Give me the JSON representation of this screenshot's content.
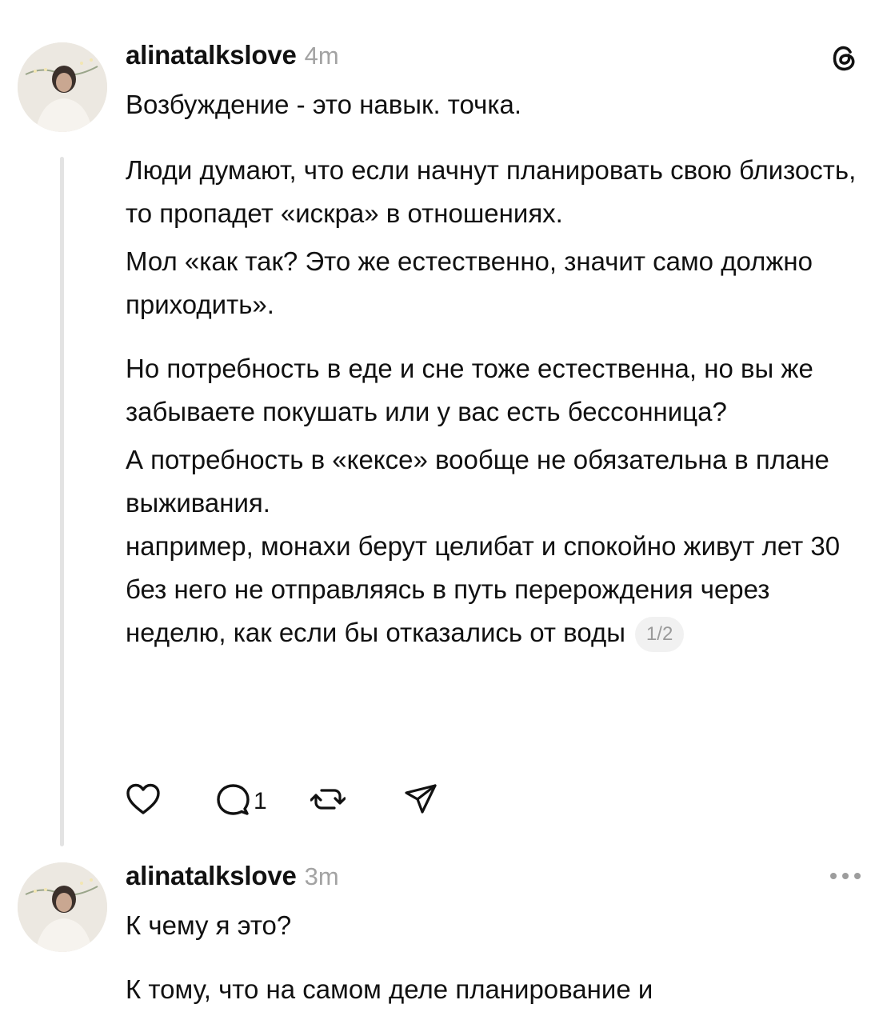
{
  "posts": [
    {
      "username": "alinatalkslove",
      "time": "4m",
      "paragraphs": [
        "Возбуждение - это навык. точка.",
        "Люди думают, что если начнут планировать свою близость, то пропадет «искра» в отношениях.",
        "Мол «как так? Это же естественно, значит само должно приходить».",
        "Но потребность в еде и сне тоже естественна, но вы же забываете покушать или у вас есть бессонница?",
        "А потребность в «кексе» вообще не обязательна в плане выживания.",
        "например, монахи берут целибат и спокойно живут лет 30 без него не отправляясь в путь перерождения через неделю, как если бы отказались от воды"
      ],
      "page_indicator": "1/2",
      "reply_count": "1",
      "icons": {
        "like": "heart-icon",
        "reply": "comment-icon",
        "repost": "repost-icon",
        "share": "share-icon",
        "brand": "threads-logo-icon"
      }
    },
    {
      "username": "alinatalkslove",
      "time": "3m",
      "paragraphs": [
        "К чему я это?",
        "К тому, что на самом деле планирование и"
      ],
      "icons": {
        "more": "more-icon"
      }
    }
  ]
}
